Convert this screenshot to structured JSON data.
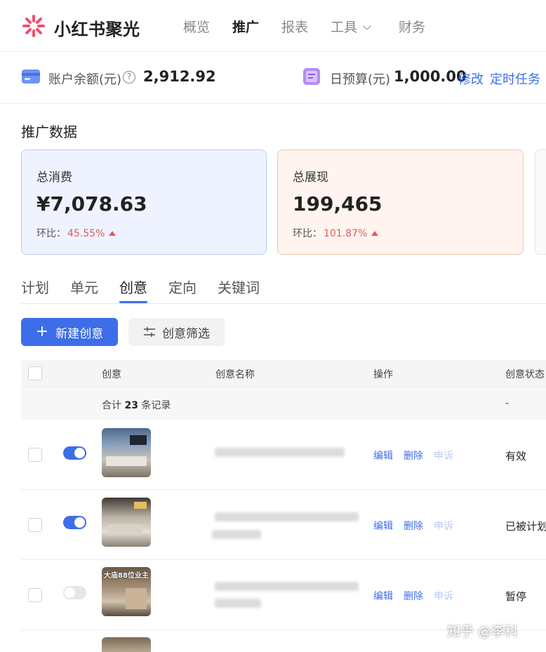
{
  "header": {
    "brand": "小红书聚光",
    "nav": [
      {
        "label": "概览"
      },
      {
        "label": "推广"
      },
      {
        "label": "报表"
      },
      {
        "label": "工具"
      },
      {
        "label": "财务"
      }
    ],
    "active_nav": "推广"
  },
  "account": {
    "balance_label": "账户余额(元)",
    "balance_value": "2,912.92",
    "budget_label": "日预算(元)",
    "budget_value": "1,000.00",
    "edit_link": "修改",
    "schedule_link": "定时任务"
  },
  "stats": {
    "section_title": "推广数据",
    "cards": [
      {
        "label": "总消费",
        "value": "¥7,078.63",
        "ratio_label": "环比：",
        "ratio_value": "45.55%"
      },
      {
        "label": "总展现",
        "value": "199,465",
        "ratio_label": "环比：",
        "ratio_value": "101.87%"
      }
    ]
  },
  "tabs": [
    {
      "label": "计划"
    },
    {
      "label": "单元"
    },
    {
      "label": "创意"
    },
    {
      "label": "定向"
    },
    {
      "label": "关键词"
    }
  ],
  "active_tab": "创意",
  "actions": {
    "new_label": "新建创意",
    "filter_label": "创意筛选"
  },
  "table": {
    "columns": [
      "创意",
      "创意名称",
      "操作",
      "创意状态"
    ],
    "summary_prefix": "合计",
    "summary_count": "23",
    "summary_suffix": "条记录",
    "summary_dash": "-",
    "rows": [
      {
        "enabled": true,
        "thumb_text": "",
        "ops": [
          "编辑",
          "删除",
          "申诉"
        ],
        "status": "有效"
      },
      {
        "enabled": true,
        "thumb_text": "",
        "ops": [
          "编辑",
          "删除",
          "申诉"
        ],
        "status": "已被计划"
      },
      {
        "enabled": false,
        "thumb_text": "大庙88位业主",
        "ops": [
          "编辑",
          "删除",
          "申诉"
        ],
        "status": "暂停"
      }
    ]
  },
  "watermark": "知乎 @李科",
  "colors": {
    "accent": "#3d6ee8",
    "ratio_up": "#e05a5a",
    "card_blue_bg": "#eef3ff",
    "card_orange_bg": "#fff4ef"
  }
}
